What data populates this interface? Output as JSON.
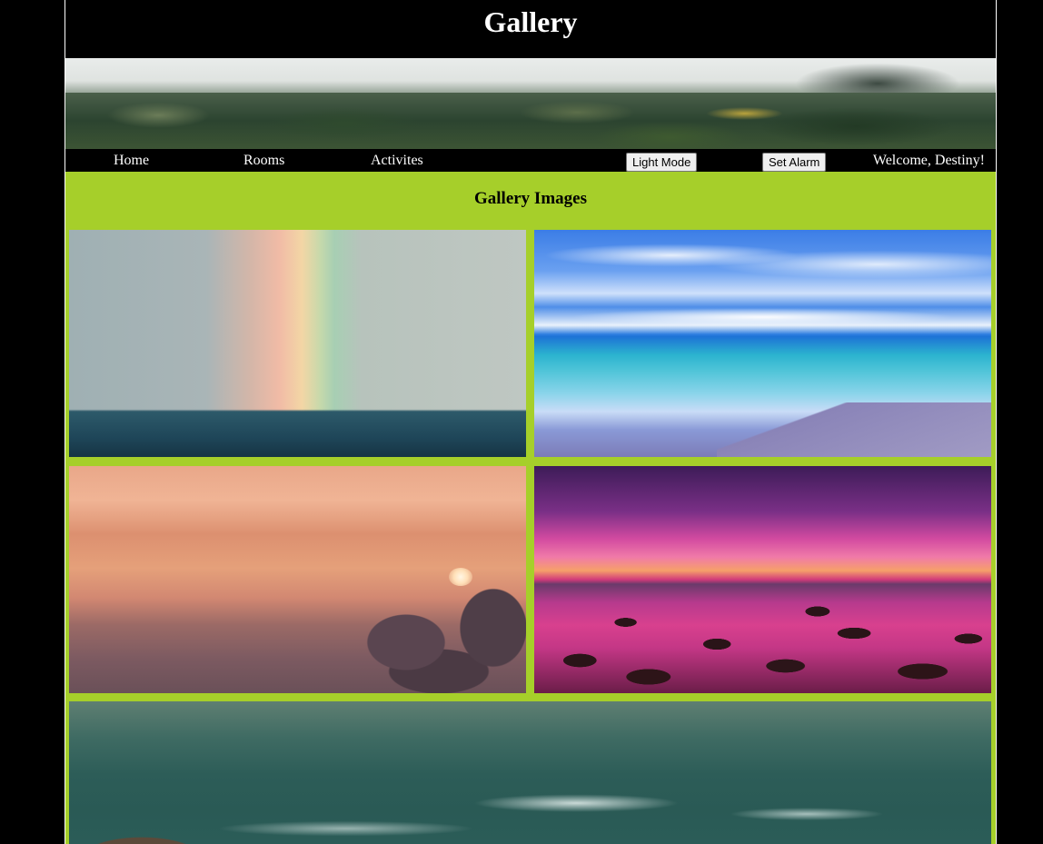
{
  "header": {
    "title": "Gallery"
  },
  "nav": {
    "home": "Home",
    "rooms": "Rooms",
    "activities": "Activites",
    "light_mode": "Light Mode",
    "set_alarm": "Set Alarm",
    "welcome": "Welcome, Destiny!"
  },
  "main": {
    "section_title": "Gallery Images"
  },
  "colors": {
    "page_background": "#000000",
    "content_background": "#a6cf2a",
    "text_on_dark": "#ffffff"
  }
}
